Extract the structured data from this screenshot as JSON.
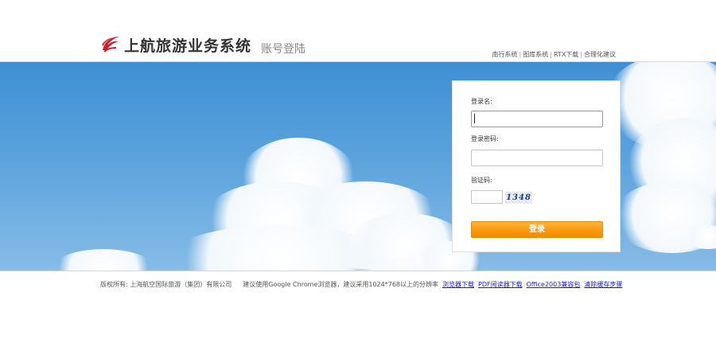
{
  "header": {
    "brand": "上航旅游业务系统",
    "subtitle": "账号登陆",
    "links": [
      "南行系统",
      "图库系统",
      "RTX下载",
      "合理化建议"
    ]
  },
  "login": {
    "username_label": "登录名:",
    "username_value": "",
    "password_label": "登录密码:",
    "password_value": "",
    "captcha_label": "验证码:",
    "captcha_value": "",
    "captcha_text": "1348",
    "submit_label": "登录"
  },
  "footer": {
    "copyright": "版权所有: 上海航空国际旅游（集团）有限公司",
    "browser_note": "建议使用Google Chrome浏览器，建议采用1024*768以上的分辨率",
    "links": [
      "浏览器下载",
      "PDF阅读器下载",
      "Office2003兼容包",
      "清除缓存步骤"
    ]
  },
  "colors": {
    "accent": "#fb9a0e",
    "sky": "#5aa2dc",
    "link": "#1a1adb",
    "logo": "#c8202a"
  },
  "icons": {
    "logo": "airline-bird-logo-icon"
  }
}
